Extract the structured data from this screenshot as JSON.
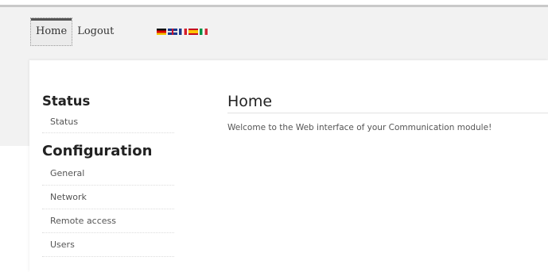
{
  "nav": {
    "items": [
      {
        "label": "Home",
        "active": true
      },
      {
        "label": "Logout",
        "active": false
      }
    ],
    "flags": [
      "de",
      "gb",
      "fr",
      "es",
      "it"
    ]
  },
  "sidebar": {
    "status_heading": "Status",
    "status_items": [
      "Status"
    ],
    "config_heading": "Configuration",
    "config_items": [
      "General",
      "Network",
      "Remote access",
      "Users"
    ]
  },
  "main": {
    "title": "Home",
    "welcome": "Welcome to the Web interface of your Communication module!"
  }
}
